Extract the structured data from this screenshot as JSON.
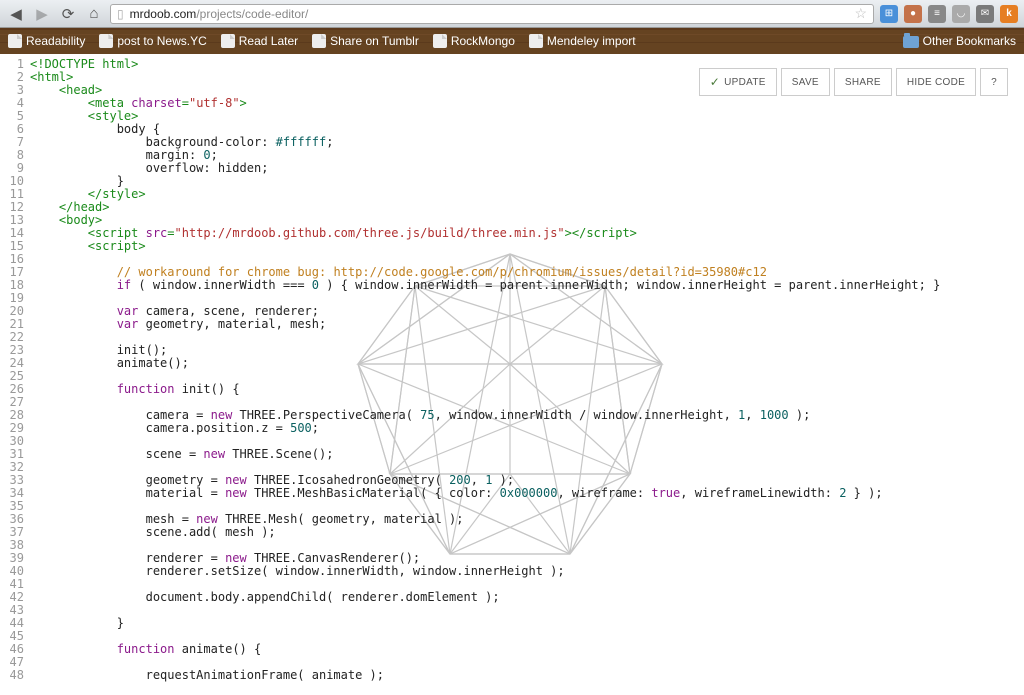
{
  "browser": {
    "url_domain": "mrdoob.com",
    "url_path": "/projects/code-editor/",
    "bookmarks": [
      "Readability",
      "post to News.YC",
      "Read Later",
      "Share on Tumblr",
      "RockMongo",
      "Mendeley import"
    ],
    "other_bookmarks": "Other Bookmarks"
  },
  "actions": {
    "update": "UPDATE",
    "save": "SAVE",
    "share": "SHARE",
    "hide_code": "HIDE CODE",
    "help": "?"
  },
  "code_lines": [
    [
      [
        "tag",
        "<!DOCTYPE html>"
      ]
    ],
    [
      [
        "tag",
        "<html>"
      ]
    ],
    [
      [
        "txt",
        "    "
      ],
      [
        "tag",
        "<head>"
      ]
    ],
    [
      [
        "txt",
        "        "
      ],
      [
        "tag",
        "<meta "
      ],
      [
        "attr",
        "charset"
      ],
      [
        "tag",
        "="
      ],
      [
        "str",
        "\"utf-8\""
      ],
      [
        "tag",
        ">"
      ]
    ],
    [
      [
        "txt",
        "        "
      ],
      [
        "tag",
        "<style>"
      ]
    ],
    [
      [
        "txt",
        "            body {"
      ]
    ],
    [
      [
        "txt",
        "                background-color: "
      ],
      [
        "num",
        "#ffffff"
      ],
      [
        "txt",
        ";"
      ]
    ],
    [
      [
        "txt",
        "                margin: "
      ],
      [
        "num",
        "0"
      ],
      [
        "txt",
        ";"
      ]
    ],
    [
      [
        "txt",
        "                overflow: hidden;"
      ]
    ],
    [
      [
        "txt",
        "            }"
      ]
    ],
    [
      [
        "txt",
        "        "
      ],
      [
        "tag",
        "</style>"
      ]
    ],
    [
      [
        "txt",
        "    "
      ],
      [
        "tag",
        "</head>"
      ]
    ],
    [
      [
        "txt",
        "    "
      ],
      [
        "tag",
        "<body>"
      ]
    ],
    [
      [
        "txt",
        "        "
      ],
      [
        "tag",
        "<script "
      ],
      [
        "attr",
        "src"
      ],
      [
        "tag",
        "="
      ],
      [
        "str",
        "\"http://mrdoob.github.com/three.js/build/three.min.js\""
      ],
      [
        "tag",
        "></script>"
      ]
    ],
    [
      [
        "txt",
        "        "
      ],
      [
        "tag",
        "<script>"
      ]
    ],
    [],
    [
      [
        "txt",
        "            "
      ],
      [
        "com",
        "// workaround for chrome bug: http://code.google.com/p/chromium/issues/detail?id=35980#c12"
      ]
    ],
    [
      [
        "txt",
        "            "
      ],
      [
        "kw",
        "if"
      ],
      [
        "txt",
        " ( window.innerWidth === "
      ],
      [
        "num",
        "0"
      ],
      [
        "txt",
        " ) { window.innerWidth = parent.innerWidth; window.innerHeight = parent.innerHeight; }"
      ]
    ],
    [],
    [
      [
        "txt",
        "            "
      ],
      [
        "kw",
        "var"
      ],
      [
        "txt",
        " camera, scene, renderer;"
      ]
    ],
    [
      [
        "txt",
        "            "
      ],
      [
        "kw",
        "var"
      ],
      [
        "txt",
        " geometry, material, mesh;"
      ]
    ],
    [],
    [
      [
        "txt",
        "            init();"
      ]
    ],
    [
      [
        "txt",
        "            animate();"
      ]
    ],
    [],
    [
      [
        "txt",
        "            "
      ],
      [
        "kw",
        "function"
      ],
      [
        "txt",
        " "
      ],
      [
        "fn",
        "init"
      ],
      [
        "txt",
        "() {"
      ]
    ],
    [],
    [
      [
        "txt",
        "                camera = "
      ],
      [
        "kw",
        "new"
      ],
      [
        "txt",
        " THREE.PerspectiveCamera( "
      ],
      [
        "num",
        "75"
      ],
      [
        "txt",
        ", window.innerWidth / window.innerHeight, "
      ],
      [
        "num",
        "1"
      ],
      [
        "txt",
        ", "
      ],
      [
        "num",
        "1000"
      ],
      [
        "txt",
        " );"
      ]
    ],
    [
      [
        "txt",
        "                camera.position.z = "
      ],
      [
        "num",
        "500"
      ],
      [
        "txt",
        ";"
      ]
    ],
    [],
    [
      [
        "txt",
        "                scene = "
      ],
      [
        "kw",
        "new"
      ],
      [
        "txt",
        " THREE.Scene();"
      ]
    ],
    [],
    [
      [
        "txt",
        "                geometry = "
      ],
      [
        "kw",
        "new"
      ],
      [
        "txt",
        " THREE.IcosahedronGeometry( "
      ],
      [
        "num",
        "200"
      ],
      [
        "txt",
        ", "
      ],
      [
        "num",
        "1"
      ],
      [
        "txt",
        " );"
      ]
    ],
    [
      [
        "txt",
        "                material = "
      ],
      [
        "kw",
        "new"
      ],
      [
        "txt",
        " THREE.MeshBasicMaterial( { color: "
      ],
      [
        "num",
        "0x000000"
      ],
      [
        "txt",
        ", wireframe: "
      ],
      [
        "bool",
        "true"
      ],
      [
        "txt",
        ", wireframeLinewidth: "
      ],
      [
        "num",
        "2"
      ],
      [
        "txt",
        " } );"
      ]
    ],
    [],
    [
      [
        "txt",
        "                mesh = "
      ],
      [
        "kw",
        "new"
      ],
      [
        "txt",
        " THREE.Mesh( geometry, material );"
      ]
    ],
    [
      [
        "txt",
        "                scene.add( mesh );"
      ]
    ],
    [],
    [
      [
        "txt",
        "                renderer = "
      ],
      [
        "kw",
        "new"
      ],
      [
        "txt",
        " THREE.CanvasRenderer();"
      ]
    ],
    [
      [
        "txt",
        "                renderer.setSize( window.innerWidth, window.innerHeight );"
      ]
    ],
    [],
    [
      [
        "txt",
        "                document.body.appendChild( renderer.domElement );"
      ]
    ],
    [],
    [
      [
        "txt",
        "            }"
      ]
    ],
    [],
    [
      [
        "txt",
        "            "
      ],
      [
        "kw",
        "function"
      ],
      [
        "txt",
        " "
      ],
      [
        "fn",
        "animate"
      ],
      [
        "txt",
        "() {"
      ]
    ],
    [],
    [
      [
        "txt",
        "                requestAnimationFrame( animate );"
      ]
    ]
  ]
}
